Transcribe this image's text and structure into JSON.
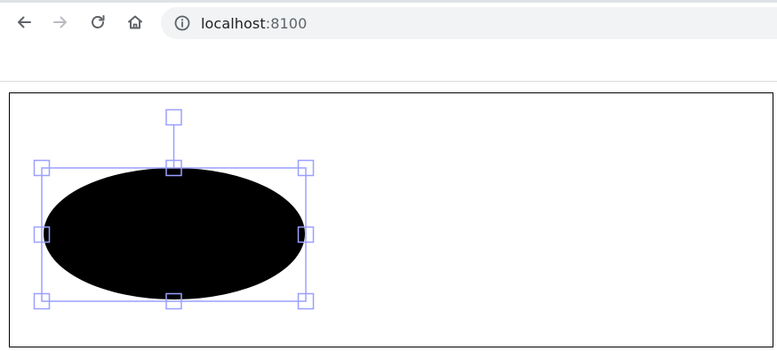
{
  "browser": {
    "nav": {
      "back_icon": "arrow-left-icon",
      "forward_icon": "arrow-right-icon",
      "reload_icon": "reload-icon",
      "home_icon": "home-icon"
    },
    "address": {
      "host": "localhost",
      "port": ":8100",
      "info_icon": "info-icon"
    }
  },
  "canvas": {
    "shape": {
      "type": "ellipse",
      "fill": "#000000"
    },
    "selection": {
      "stroke_color": "#9aa0ff",
      "handles": [
        "top-left",
        "top",
        "top-right",
        "left",
        "right",
        "bottom-left",
        "bottom",
        "bottom-right",
        "rotate"
      ]
    }
  }
}
